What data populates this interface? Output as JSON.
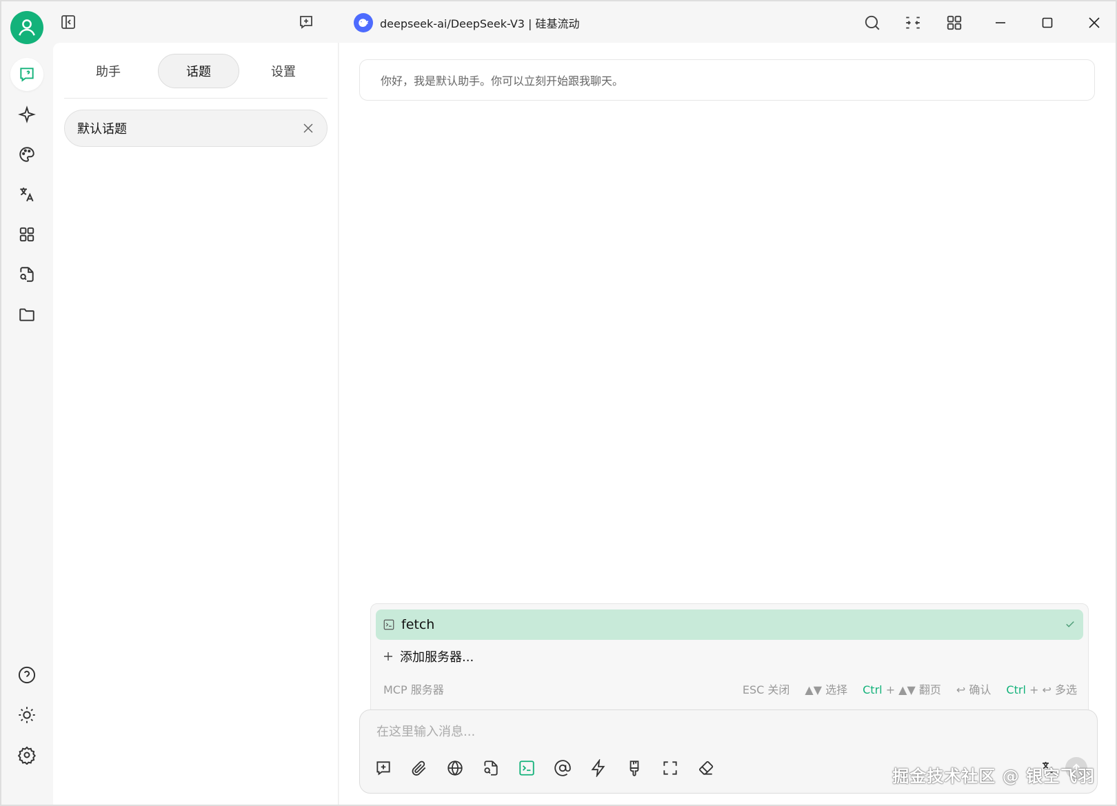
{
  "window": {
    "model_title": "deepseek-ai/DeepSeek-V3 | 硅基流动"
  },
  "panel": {
    "tabs": [
      {
        "label": "助手"
      },
      {
        "label": "话题"
      },
      {
        "label": "设置"
      }
    ],
    "active_tab": "话题",
    "topics": [
      {
        "label": "默认话题"
      }
    ]
  },
  "chat": {
    "welcome_message": "你好，我是默认助手。你可以立刻开始跟我聊天。",
    "input_placeholder": "在这里输入消息..."
  },
  "mcp_popup": {
    "items": [
      {
        "label": "fetch",
        "selected": true
      }
    ],
    "add_label": "添加服务器...",
    "title": "MCP 服务器",
    "hints": {
      "close_key": "ESC",
      "close_label": "关闭",
      "select_key": "▲▼",
      "select_label": "选择",
      "page_key": "Ctrl",
      "page_plus": "+ ▲▼",
      "page_label": "翻页",
      "confirm_key": "↩",
      "confirm_label": "确认",
      "multi_key": "Ctrl",
      "multi_plus": "+ ↩",
      "multi_label": "多选"
    }
  },
  "watermark": "掘金技术社区 @ 银空飞羽",
  "colors": {
    "accent": "#13b27a",
    "selected_row": "#c8ead9",
    "model_logo": "#4d6bfe"
  }
}
